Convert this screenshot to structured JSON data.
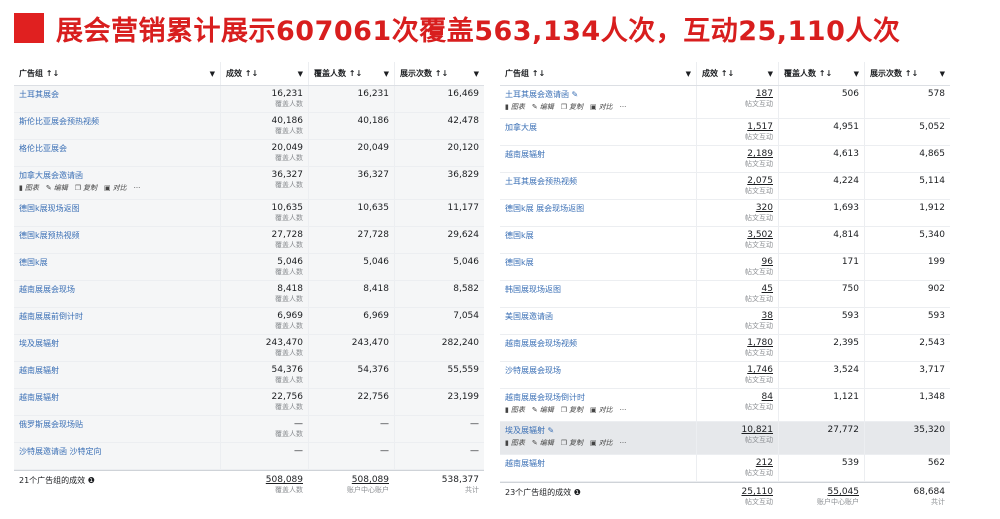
{
  "banner": {
    "title": "展会营销累计展示607061次覆盖563,134人次，互动25,110人次"
  },
  "tool_labels": {
    "chart": "图表",
    "edit": "编辑",
    "copy": "复制",
    "compare": "对比",
    "more": "···"
  },
  "left": {
    "headers": [
      "广告组 ↑↓",
      "成效 ↑↓",
      "覆盖人数 ↑↓",
      "展示次数 ↑↓"
    ],
    "rows": [
      {
        "name": "土耳其展会",
        "result": "16,231",
        "unit": "覆盖人数",
        "reach": "16,231",
        "impr": "16,469"
      },
      {
        "name": "斯伦比亚展会预热视频",
        "result": "40,186",
        "unit": "覆盖人数",
        "reach": "40,186",
        "impr": "42,478"
      },
      {
        "name": "格伦比亚展会",
        "result": "20,049",
        "unit": "覆盖人数",
        "reach": "20,049",
        "impr": "20,120"
      },
      {
        "name": "加拿大展会邀请函",
        "result": "36,327",
        "unit": "覆盖人数",
        "reach": "36,327",
        "impr": "36,829",
        "tools": true
      },
      {
        "name": "德国k展现场返图",
        "result": "10,635",
        "unit": "覆盖人数",
        "reach": "10,635",
        "impr": "11,177"
      },
      {
        "name": "德国k展预热视频",
        "result": "27,728",
        "unit": "覆盖人数",
        "reach": "27,728",
        "impr": "29,624"
      },
      {
        "name": "德国k展",
        "result": "5,046",
        "unit": "覆盖人数",
        "reach": "5,046",
        "impr": "5,046"
      },
      {
        "name": "越南展展会现场",
        "result": "8,418",
        "unit": "覆盖人数",
        "reach": "8,418",
        "impr": "8,582"
      },
      {
        "name": "越南展展前倒计时",
        "result": "6,969",
        "unit": "覆盖人数",
        "reach": "6,969",
        "impr": "7,054"
      },
      {
        "name": "埃及展辐射",
        "result": "243,470",
        "unit": "覆盖人数",
        "reach": "243,470",
        "impr": "282,240"
      },
      {
        "name": "越南展辐射",
        "result": "54,376",
        "unit": "覆盖人数",
        "reach": "54,376",
        "impr": "55,559"
      },
      {
        "name": "越南展辐射",
        "result": "22,756",
        "unit": "覆盖人数",
        "reach": "22,756",
        "impr": "23,199"
      },
      {
        "name": "俄罗斯展会现场贴",
        "result": "—",
        "unit": "覆盖人数",
        "reach": "—",
        "impr": "—"
      },
      {
        "name": "沙特展邀请函 沙特定向",
        "result": "—",
        "unit": "",
        "reach": "—",
        "impr": "—"
      }
    ],
    "footer": {
      "label": "21个广告组的成效 ❶",
      "result": "508,089",
      "result_unit": "覆盖人数",
      "reach": "508,089",
      "reach_unit": "账户中心账户",
      "impr": "538,377",
      "impr_unit": "共计"
    }
  },
  "right": {
    "headers": [
      "广告组 ↑↓",
      "成效 ↑↓",
      "覆盖人数 ↑↓",
      "展示次数 ↑↓"
    ],
    "rows": [
      {
        "name": "土耳其展会邀请函 ✎",
        "result": "187",
        "unit": "帖文互动",
        "reach": "506",
        "impr": "578",
        "tools": true
      },
      {
        "name": "加拿大展",
        "result": "1,517",
        "unit": "帖文互动",
        "reach": "4,951",
        "impr": "5,052"
      },
      {
        "name": "越南展辐射",
        "result": "2,189",
        "unit": "帖文互动",
        "reach": "4,613",
        "impr": "4,865"
      },
      {
        "name": "土耳其展会预热视频",
        "result": "2,075",
        "unit": "帖文互动",
        "reach": "4,224",
        "impr": "5,114"
      },
      {
        "name": "德国k展 展会现场返图",
        "result": "320",
        "unit": "帖文互动",
        "reach": "1,693",
        "impr": "1,912"
      },
      {
        "name": "德国k展",
        "result": "3,502",
        "unit": "帖文互动",
        "reach": "4,814",
        "impr": "5,340"
      },
      {
        "name": "德国k展",
        "result": "96",
        "unit": "帖文互动",
        "reach": "171",
        "impr": "199"
      },
      {
        "name": "韩国展现场返图",
        "result": "45",
        "unit": "帖文互动",
        "reach": "750",
        "impr": "902"
      },
      {
        "name": "美国展邀请函",
        "result": "38",
        "unit": "帖文互动",
        "reach": "593",
        "impr": "593"
      },
      {
        "name": "越南展展会现场视频",
        "result": "1,780",
        "unit": "帖文互动",
        "reach": "2,395",
        "impr": "2,543"
      },
      {
        "name": "沙特展展会现场",
        "result": "1,746",
        "unit": "帖文互动",
        "reach": "3,524",
        "impr": "3,717"
      },
      {
        "name": "越南展展会现场倒计时",
        "result": "84",
        "unit": "帖文互动",
        "reach": "1,121",
        "impr": "1,348",
        "tools": true
      },
      {
        "name": "埃及展辐射 ✎",
        "result": "10,821",
        "unit": "帖文互动",
        "reach": "27,772",
        "impr": "35,320",
        "tools": true,
        "highlight": true
      },
      {
        "name": "越南展辐射",
        "result": "212",
        "unit": "帖文互动",
        "reach": "539",
        "impr": "562"
      }
    ],
    "footer": {
      "label": "23个广告组的成效 ❶",
      "result": "25,110",
      "result_unit": "帖文互动",
      "reach": "55,045",
      "reach_unit": "账户中心账户",
      "impr": "68,684",
      "impr_unit": "共计"
    }
  }
}
